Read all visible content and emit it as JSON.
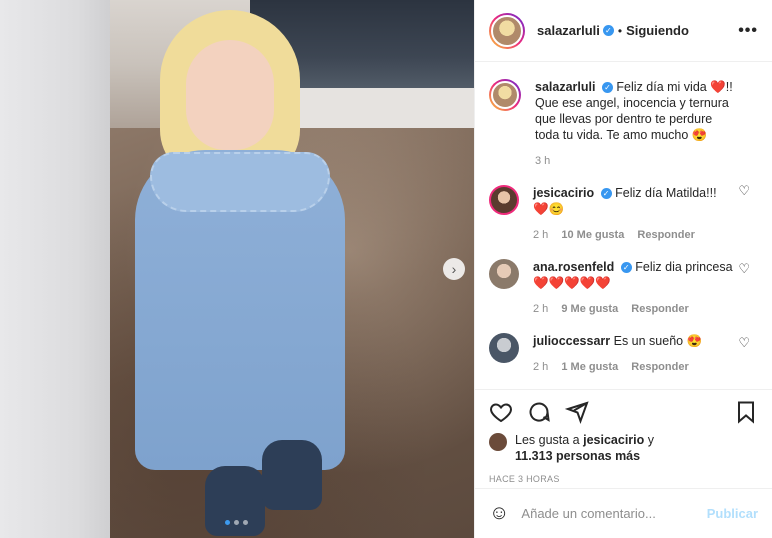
{
  "post": {
    "author": "salazarluli",
    "follow_status": "Siguiendo",
    "separator": "•",
    "more_icon": "more-icon",
    "caption": "Feliz día mi vida ❤️!! Que ese angel, inocencia y ternura que llevas por dentro te perdure toda tu vida. Te amo mucho 😍",
    "caption_time": "3 h"
  },
  "comments": [
    {
      "user": "jesicacirio",
      "text": "Feliz día Matilda!!! ❤️😊",
      "time": "2 h",
      "likes": "10 Me gusta",
      "reply": "Responder",
      "avatar_color": "#5a3b2e"
    },
    {
      "user": "ana.rosenfeld",
      "text": "Feliz dia princesa ❤️❤️❤️❤️❤️",
      "time": "2 h",
      "likes": "9 Me gusta",
      "reply": "Responder",
      "avatar_color": "#8b7a6a"
    },
    {
      "user": "julioccessarr",
      "text": "Es un sueño 😍",
      "time": "2 h",
      "likes": "1 Me gusta",
      "reply": "Responder",
      "avatar_color": "#4a5666"
    }
  ],
  "likes": {
    "prefix": "Les gusta a",
    "user": "jesicacirio",
    "suffix": "y",
    "count": "11.313 personas más"
  },
  "time_ago": "HACE 3 HORAS",
  "add_comment": {
    "placeholder": "Añade un comentario...",
    "publish": "Publicar"
  },
  "colors": {
    "accent": "#3897f0",
    "publish_disabled": "#b2dffc",
    "heart": "#ed4956"
  }
}
